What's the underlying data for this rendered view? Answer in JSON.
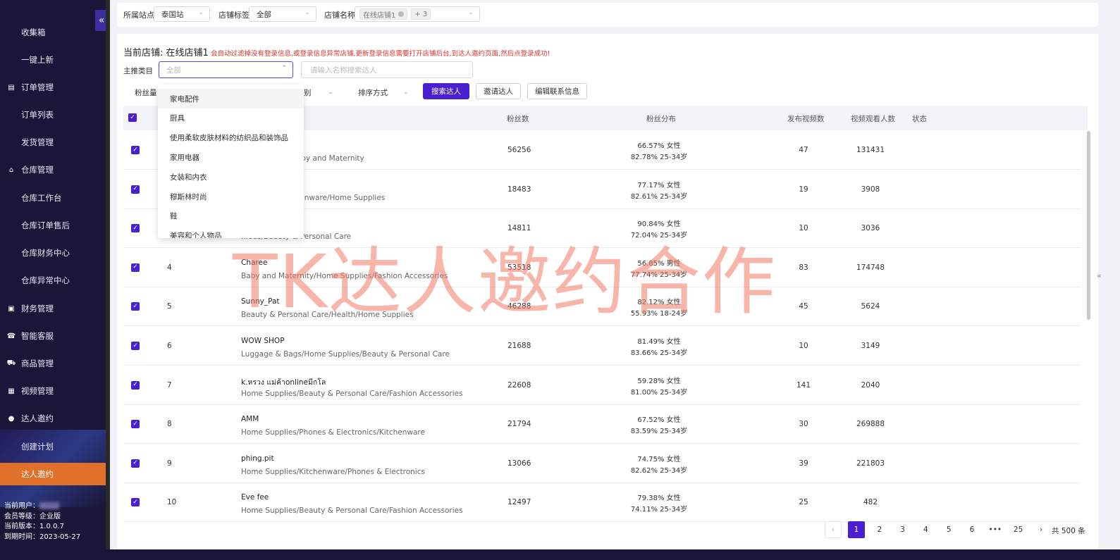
{
  "sidebar": {
    "items": [
      {
        "label": "收集箱",
        "type": "sub"
      },
      {
        "label": "一键上新",
        "type": "sub"
      },
      {
        "label": "订单管理",
        "type": "group",
        "icon": "order-icon"
      },
      {
        "label": "订单列表",
        "type": "sub"
      },
      {
        "label": "发货管理",
        "type": "sub"
      },
      {
        "label": "仓库管理",
        "type": "group",
        "icon": "warehouse-icon"
      },
      {
        "label": "仓库工作台",
        "type": "sub"
      },
      {
        "label": "仓库订单售后",
        "type": "sub"
      },
      {
        "label": "仓库财务中心",
        "type": "sub"
      },
      {
        "label": "仓库异常中心",
        "type": "sub"
      },
      {
        "label": "财务管理",
        "type": "group",
        "icon": "finance-icon"
      },
      {
        "label": "智能客服",
        "type": "group",
        "icon": "support-icon"
      },
      {
        "label": "商品管理",
        "type": "group",
        "icon": "cart-icon"
      },
      {
        "label": "视频管理",
        "type": "group",
        "icon": "video-icon"
      },
      {
        "label": "达人邀约",
        "type": "group",
        "icon": "user-icon"
      },
      {
        "label": "创建计划",
        "type": "sub"
      },
      {
        "label": "达人邀约",
        "type": "sub",
        "active": true
      }
    ],
    "user": {
      "current_user": "当前用户：",
      "level": "会员等级：企业版",
      "version": "当前版本：1.0.0.7",
      "expiry": "到期时间：2023-05-27"
    }
  },
  "filters": {
    "site_label": "所属站点",
    "site_value": "泰国站",
    "tag_label": "店铺标签",
    "tag_value": "全部",
    "shop_label": "店铺名称",
    "shop_tag": "在线店铺1",
    "shop_more": "+ 3"
  },
  "header": {
    "current_shop": "当前店铺: 在线店铺1",
    "warning": "会自动过滤掉没有登录信息,或登录信息异常店铺,更新登录信息需要打开店铺后台,到达人邀约页面,然后点登录成功!"
  },
  "search": {
    "category_label": "主推类目",
    "category_placeholder": "全部",
    "name_placeholder": "请输入名称搜索达人"
  },
  "toolbar": {
    "fans_label": "粉丝量",
    "gender_label": "别",
    "sort_label": "排序方式",
    "search_btn": "搜索达人",
    "invite_btn": "邀请达人",
    "edit_btn": "编辑联系信息"
  },
  "table": {
    "headers": {
      "fans": "粉丝数",
      "dist": "粉丝分布",
      "videos": "发布视频数",
      "views": "视频观看人数",
      "status": "状态"
    },
    "rows": [
      {
        "idx": "",
        "name": "",
        "cats": "...itchenware/Baby and Maternity",
        "fans": "56256",
        "d1": "66.57% 女性",
        "d2": "82.78% 25-34岁",
        "videos": "47",
        "views": "131431"
      },
      {
        "idx": "",
        "name": "...",
        "cats": "...nishings/Kitchenware/Home Supplies",
        "fans": "18483",
        "d1": "77.17% 女性",
        "d2": "82.61% 25-34岁",
        "videos": "19",
        "views": "3908"
      },
      {
        "idx": "",
        "name": "",
        "cats": "...oes/Beauty & Personal Care",
        "fans": "14811",
        "d1": "90.84% 女性",
        "d2": "72.04% 25-34岁",
        "videos": "10",
        "views": "3036"
      },
      {
        "idx": "4",
        "name": "Charee",
        "cats": "Baby and Maternity/Home Supplies/Fashion Accessories",
        "fans": "53518",
        "d1": "56.85% 男性",
        "d2": "77.74% 25-34岁",
        "videos": "83",
        "views": "174748"
      },
      {
        "idx": "5",
        "name": "Sunny_Pat",
        "cats": "Beauty & Personal Care/Health/Home Supplies",
        "fans": "46288",
        "d1": "82.12% 女性",
        "d2": "55.93% 18-24岁",
        "videos": "45",
        "views": "5624"
      },
      {
        "idx": "6",
        "name": "WOW SHOP",
        "cats": "Luggage & Bags/Home Supplies/Beauty & Personal Care",
        "fans": "21688",
        "d1": "81.49% 女性",
        "d2": "83.66% 25-34岁",
        "videos": "10",
        "views": "3149"
      },
      {
        "idx": "7",
        "name": "k.หรวง แม่ค้าonlineมีกโล",
        "cats": "Home Supplies/Beauty & Personal Care/Fashion Accessories",
        "fans": "22608",
        "d1": "59.28% 女性",
        "d2": "81.00% 25-34岁",
        "videos": "141",
        "views": "2040"
      },
      {
        "idx": "8",
        "name": "AMM",
        "cats": "Home Supplies/Phones & Electronics/Kitchenware",
        "fans": "21794",
        "d1": "67.52% 女性",
        "d2": "83.59% 25-34岁",
        "videos": "30",
        "views": "269888"
      },
      {
        "idx": "9",
        "name": "phing.pit",
        "cats": "Home Supplies/Kitchenware/Phones & Electronics",
        "fans": "13066",
        "d1": "74.75% 女性",
        "d2": "82.62% 25-34岁",
        "videos": "39",
        "views": "221803"
      },
      {
        "idx": "10",
        "name": "Eve fee",
        "cats": "Home Supplies/Beauty & Personal Care/Fashion Accessories",
        "fans": "12497",
        "d1": "79.38% 女性",
        "d2": "74.11% 25-34岁",
        "videos": "25",
        "views": "482"
      }
    ]
  },
  "dropdown": {
    "options": [
      "家电配件",
      "厨具",
      "使用柔软皮肤材料的纺织品和装饰品",
      "家用电器",
      "女装和内衣",
      "穆斯林时尚",
      "鞋",
      "美容和个人物品"
    ]
  },
  "pagination": {
    "pages": [
      "1",
      "2",
      "3",
      "4",
      "5",
      "6",
      "•••",
      "25"
    ],
    "current": "1",
    "prev": "‹",
    "next": "›",
    "total": "共 500 条"
  },
  "watermark": "TK达人邀约合作",
  "colors": {
    "primary": "#4a1fd0",
    "sidebar_bg": "#1a1638",
    "active_menu": "#e0712a",
    "warning": "#e5322d"
  }
}
